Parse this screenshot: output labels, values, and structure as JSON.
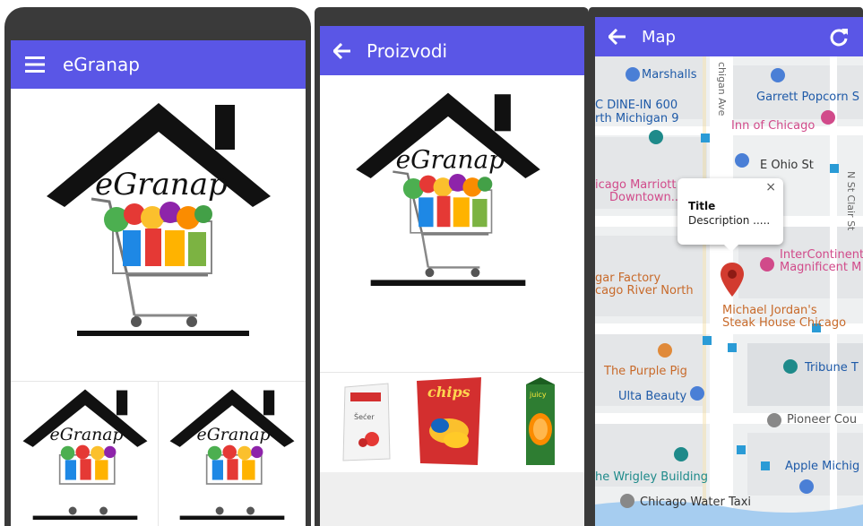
{
  "screens": {
    "home": {
      "title": "eGranap",
      "logo_text": "eGranap"
    },
    "products": {
      "title": "Proizvodi",
      "logo_text": "eGranap",
      "items": [
        {
          "name": "sugar-bag",
          "label": "Šećer"
        },
        {
          "name": "chips-bag",
          "label": "chips"
        },
        {
          "name": "juice-box",
          "label": "juicy"
        }
      ]
    },
    "map": {
      "title": "Map",
      "popup": {
        "title": "Title",
        "description": "Description ....."
      },
      "labels": [
        {
          "key": "marshalls",
          "text": "Marshalls",
          "color": "#1e5aa8"
        },
        {
          "key": "street1",
          "text": "chigan Ave",
          "color": "#666666"
        },
        {
          "key": "garrett",
          "text": "Garrett Popcorn S",
          "color": "#1e5aa8"
        },
        {
          "key": "dinein",
          "text": "C DINE-IN 600",
          "color": "#1e5aa8"
        },
        {
          "key": "michigan",
          "text": "rth Michigan 9",
          "color": "#1e5aa8"
        },
        {
          "key": "innchicago",
          "text": "Inn of Chicago",
          "color": "#d14a8a"
        },
        {
          "key": "eohio",
          "text": "E Ohio St",
          "color": "#333333"
        },
        {
          "key": "marriott1",
          "text": "icago Marriott",
          "color": "#d14a8a"
        },
        {
          "key": "marriott2",
          "text": "Downtown...",
          "color": "#d14a8a"
        },
        {
          "key": "nstclair",
          "text": "N St Clair St",
          "color": "#666666"
        },
        {
          "key": "interconti1",
          "text": "InterContinent",
          "color": "#d14a8a"
        },
        {
          "key": "interconti2",
          "text": "Magnificent M",
          "color": "#d14a8a"
        },
        {
          "key": "sugar1",
          "text": "gar Factory",
          "color": "#c86a2a"
        },
        {
          "key": "sugar2",
          "text": "cago River North",
          "color": "#c86a2a"
        },
        {
          "key": "jordan1",
          "text": "Michael Jordan's",
          "color": "#c86a2a"
        },
        {
          "key": "jordan2",
          "text": "Steak House Chicago",
          "color": "#c86a2a"
        },
        {
          "key": "purplepig",
          "text": "The Purple Pig",
          "color": "#c86a2a"
        },
        {
          "key": "tribune",
          "text": "Tribune T",
          "color": "#1e5aa8"
        },
        {
          "key": "ulta",
          "text": "Ulta Beauty",
          "color": "#1e5aa8"
        },
        {
          "key": "pioneer",
          "text": "Pioneer Cou",
          "color": "#555555"
        },
        {
          "key": "wrigley",
          "text": "he Wrigley Building",
          "color": "#1e8a8a"
        },
        {
          "key": "apple",
          "text": "Apple Michig",
          "color": "#1e5aa8"
        },
        {
          "key": "watertaxi",
          "text": "Chicago Water Taxi",
          "color": "#333333"
        }
      ]
    }
  },
  "colors": {
    "appbar": "#5a56e6",
    "phone_frame": "#3a3a3a",
    "map_bg": "#eef0f1",
    "marker": "#d23b2f"
  }
}
